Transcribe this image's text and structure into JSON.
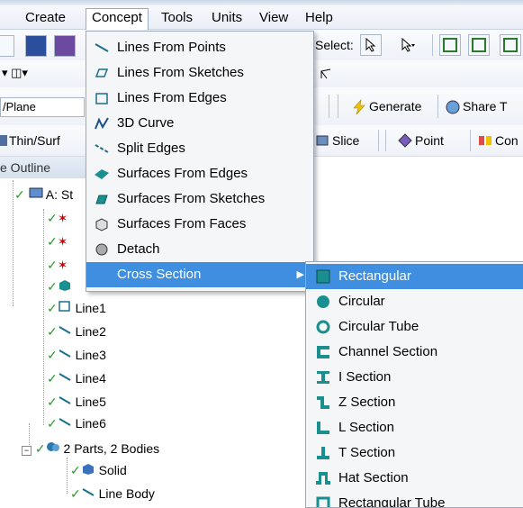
{
  "menubar": {
    "items": [
      "Create",
      "Concept",
      "Tools",
      "Units",
      "View",
      "Help"
    ]
  },
  "toolbar": {
    "select_label": "Select:",
    "plane_combo": "/Plane",
    "generate_label": "Generate",
    "share_label": "Share T",
    "thin_label": "Thin/Surf",
    "slice_label": "Slice",
    "point_label": "Point",
    "con_label": "Con"
  },
  "outline": {
    "header": "e Outline",
    "root_label": "A: St",
    "items": [
      "Line1",
      "Line2",
      "Line3",
      "Line4",
      "Line5",
      "Line6"
    ],
    "parts_label": "2 Parts, 2 Bodies",
    "solid_label": "Solid",
    "line_body_label": "Line Body"
  },
  "concept_menu": {
    "items": [
      {
        "label": "Lines From Points",
        "icon": "line-points-icon"
      },
      {
        "label": "Lines From Sketches",
        "icon": "line-sketches-icon"
      },
      {
        "label": "Lines From Edges",
        "icon": "line-edges-icon"
      },
      {
        "label": "3D Curve",
        "icon": "curve-3d-icon"
      },
      {
        "label": "Split Edges",
        "icon": "split-edges-icon"
      },
      {
        "label": "Surfaces From Edges",
        "icon": "surface-edges-icon"
      },
      {
        "label": "Surfaces From Sketches",
        "icon": "surface-sketches-icon"
      },
      {
        "label": "Surfaces From Faces",
        "icon": "surface-faces-icon"
      },
      {
        "label": "Detach",
        "icon": "detach-icon"
      },
      {
        "label": "Cross Section",
        "icon": "",
        "has_submenu": true
      }
    ]
  },
  "cross_section_menu": {
    "items": [
      {
        "label": "Rectangular",
        "icon": "rectangular-icon"
      },
      {
        "label": "Circular",
        "icon": "circular-icon"
      },
      {
        "label": "Circular Tube",
        "icon": "circular-tube-icon"
      },
      {
        "label": "Channel Section",
        "icon": "channel-section-icon"
      },
      {
        "label": "I Section",
        "icon": "i-section-icon"
      },
      {
        "label": "Z Section",
        "icon": "z-section-icon"
      },
      {
        "label": "L Section",
        "icon": "l-section-icon"
      },
      {
        "label": "T Section",
        "icon": "t-section-icon"
      },
      {
        "label": "Hat Section",
        "icon": "hat-section-icon"
      },
      {
        "label": "Rectangular Tube",
        "icon": "rectangular-tube-icon"
      }
    ]
  },
  "colors": {
    "selection": "#3f8edf",
    "teal_icon": "#1a8f8f",
    "tree_check": "#2a9a2a"
  }
}
